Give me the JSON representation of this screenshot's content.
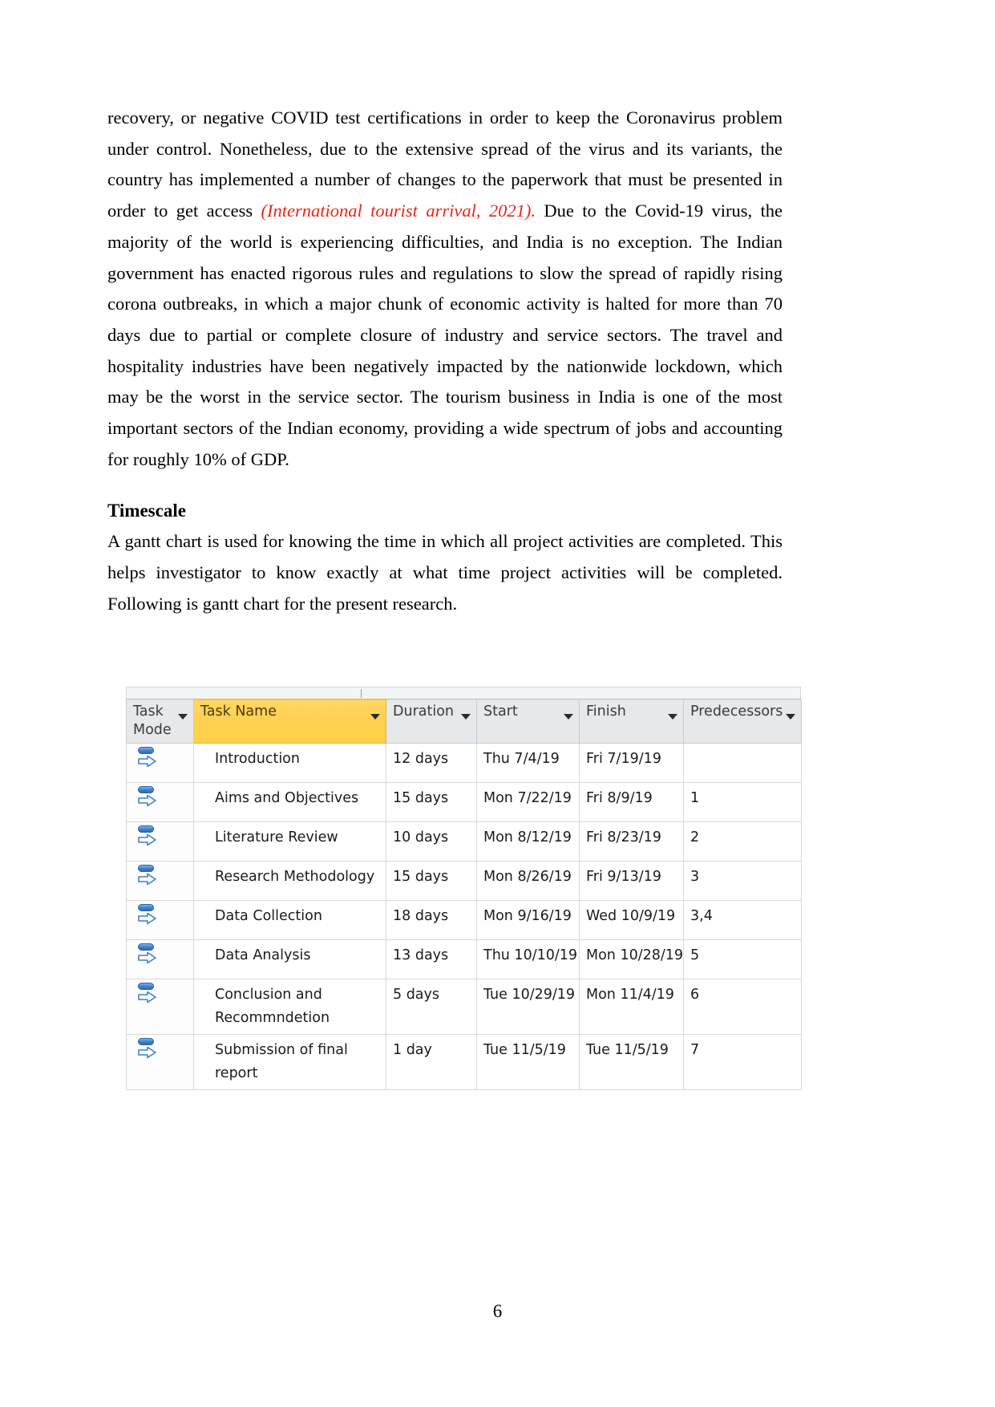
{
  "document": {
    "page_number": "6",
    "paragraphs": [
      {
        "id": "para-covid",
        "runs": [
          {
            "text": "recovery, or negative COVID test certifications in order to keep the Coronavirus problem under control. Nonetheless, due to the extensive spread of the virus and its variants, the country has implemented a number of changes to the paperwork that must be presented in order to get access ",
            "style": "normal"
          },
          {
            "text": "(International tourist arrival, 2021).",
            "style": "citation-red-italic"
          },
          {
            "text": " Due to the Covid-19 virus, the majority of the world is experiencing difficulties, and India is no exception. The Indian government has enacted rigorous rules and regulations to slow the spread of rapidly rising corona outbreaks, in which a major chunk of economic activity is halted for more than 70 days due to partial or complete closure of industry and service sectors. The travel and hospitality industries have been negatively impacted by the nationwide lockdown, which may be the worst in the service sector. The tourism business in India is one of the most important sectors of the Indian economy, providing a wide spectrum of jobs and accounting for roughly 10% of GDP.",
            "style": "normal"
          }
        ]
      }
    ],
    "heading": "Timescale",
    "timescale_paragraph": "A gantt chart is used for knowing the time in which all project activities are completed. This helps investigator to know exactly at what time project activities will be completed. Following is gantt chart for the present research."
  },
  "colors": {
    "citation_red": "#e8261b",
    "header_highlight": "#ffd152",
    "header_grey": "#e6e8ea",
    "icon_blue": "#3f7fc8"
  },
  "gantt_table": {
    "columns": [
      {
        "key": "mode",
        "label": "Task Mode",
        "highlight": false,
        "has_filter": true
      },
      {
        "key": "name",
        "label": "Task Name",
        "highlight": true,
        "has_filter": true
      },
      {
        "key": "dur",
        "label": "Duration",
        "highlight": false,
        "has_filter": true
      },
      {
        "key": "start",
        "label": "Start",
        "highlight": false,
        "has_filter": true
      },
      {
        "key": "fin",
        "label": "Finish",
        "highlight": false,
        "has_filter": true
      },
      {
        "key": "pred",
        "label": "Predecessors",
        "highlight": false,
        "has_filter": true
      }
    ],
    "rows": [
      {
        "icon": "manually-scheduled-icon",
        "name": "Introduction",
        "duration": "12 days",
        "start": "Thu 7/4/19",
        "finish": "Fri 7/19/19",
        "predecessors": ""
      },
      {
        "icon": "manually-scheduled-icon",
        "name": "Aims and Objectives",
        "duration": "15 days",
        "start": "Mon 7/22/19",
        "finish": "Fri 8/9/19",
        "predecessors": "1"
      },
      {
        "icon": "manually-scheduled-icon",
        "name": "Literature Review",
        "duration": "10 days",
        "start": "Mon 8/12/19",
        "finish": "Fri 8/23/19",
        "predecessors": "2"
      },
      {
        "icon": "manually-scheduled-icon",
        "name": "Research Methodology",
        "duration": "15 days",
        "start": "Mon 8/26/19",
        "finish": "Fri 9/13/19",
        "predecessors": "3"
      },
      {
        "icon": "manually-scheduled-icon",
        "name": "Data Collection",
        "duration": "18 days",
        "start": "Mon 9/16/19",
        "finish": "Wed 10/9/19",
        "predecessors": "3,4"
      },
      {
        "icon": "manually-scheduled-icon",
        "name": "Data Analysis",
        "duration": "13 days",
        "start": "Thu 10/10/19",
        "finish": "Mon 10/28/19",
        "predecessors": "5"
      },
      {
        "icon": "manually-scheduled-icon",
        "name": "Conclusion and Recommndetion",
        "duration": "5 days",
        "start": "Tue 10/29/19",
        "finish": "Mon 11/4/19",
        "predecessors": "6"
      },
      {
        "icon": "manually-scheduled-icon",
        "name": "Submission of final report",
        "duration": "1 day",
        "start": "Tue 11/5/19",
        "finish": "Tue 11/5/19",
        "predecessors": "7"
      }
    ]
  }
}
